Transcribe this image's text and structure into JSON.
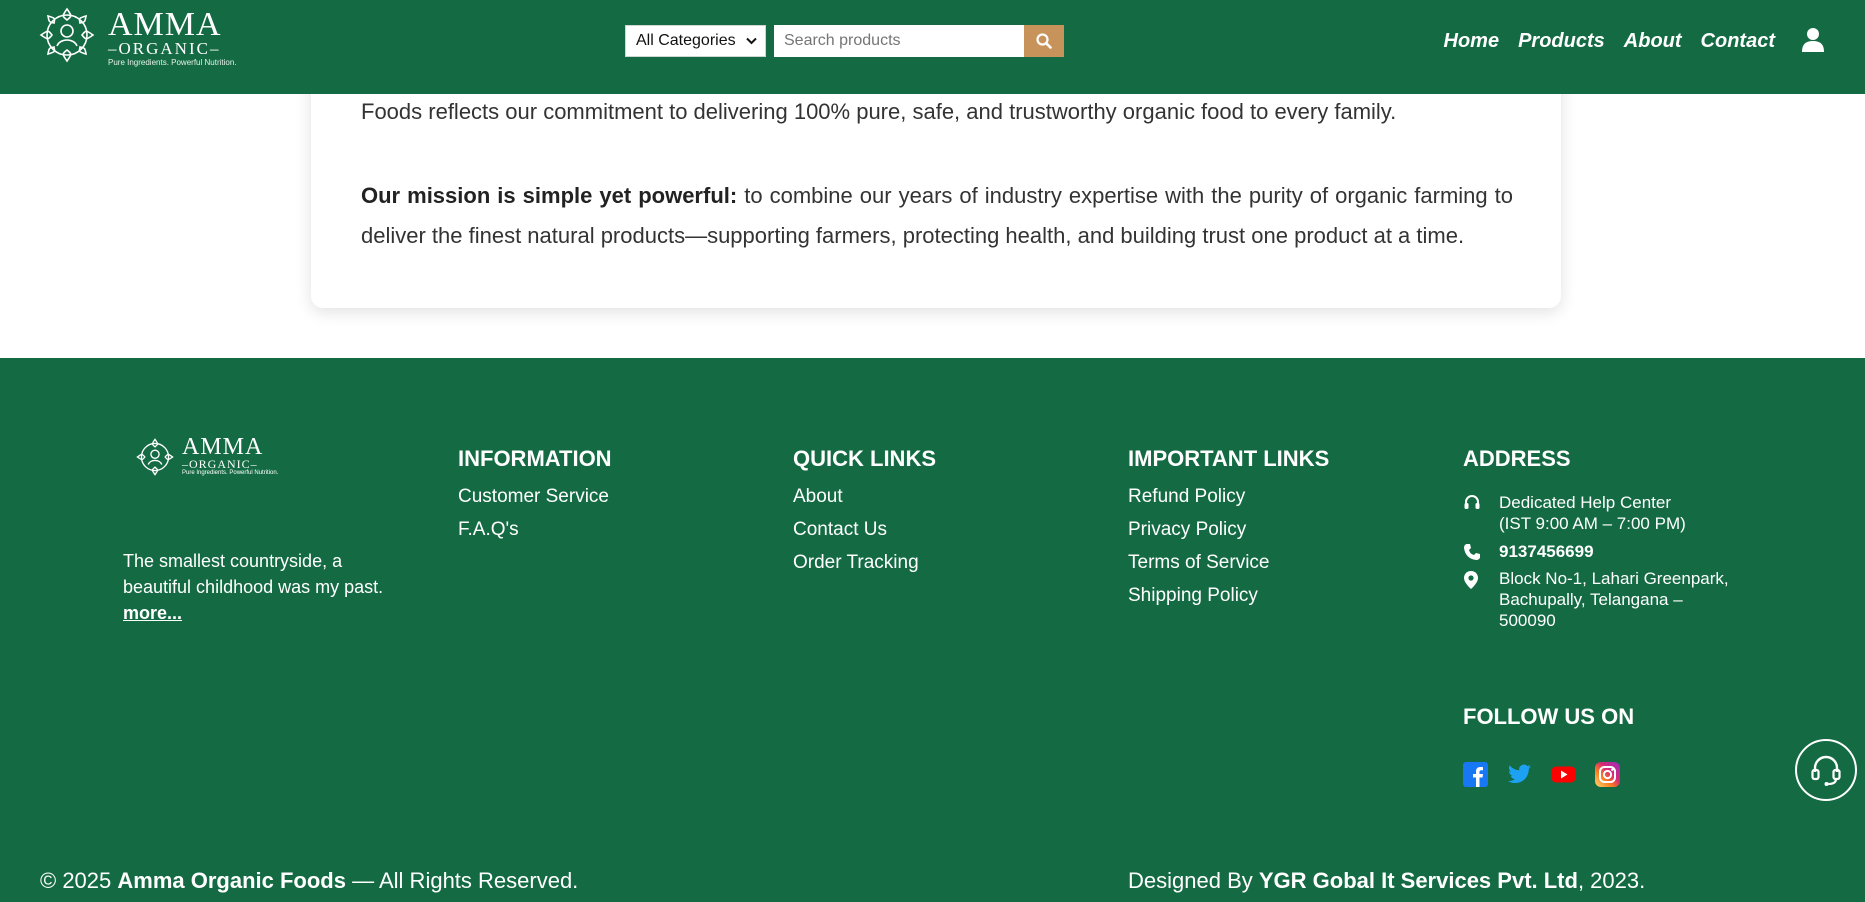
{
  "header": {
    "logo": {
      "title": "AMMA",
      "subtitle": "ORGANIC",
      "tagline": "Pure Ingredients. Powerful Nutrition."
    },
    "search": {
      "category_selected": "All Categories",
      "placeholder": "Search products"
    },
    "nav": [
      "Home",
      "Products",
      "About",
      "Contact"
    ]
  },
  "content": {
    "paragraph_top": "Foods reflects our commitment to delivering 100% pure, safe, and trustworthy organic food to every family.",
    "mission_lead": "Our mission is simple yet powerful:",
    "mission_text": " to combine our years of industry expertise with the purity of organic farming to deliver the finest natural products—supporting farmers, protecting health, and building trust one product at a time."
  },
  "footer": {
    "logo": {
      "title": "AMMA",
      "subtitle": "ORGANIC",
      "tagline": "Pure Ingredients. Powerful Nutrition."
    },
    "about": {
      "text": "The smallest countryside, a beautiful childhood was my past.",
      "more": "more..."
    },
    "information": {
      "title": "INFORMATION",
      "links": [
        "Customer Service",
        "F.A.Q's"
      ]
    },
    "quick_links": {
      "title": "QUICK LINKS",
      "links": [
        "About",
        "Contact Us",
        "Order Tracking"
      ]
    },
    "important_links": {
      "title": "IMPORTANT LINKS",
      "links": [
        "Refund Policy",
        "Privacy Policy",
        "Terms of Service",
        "Shipping Policy"
      ]
    },
    "address": {
      "title": "ADDRESS",
      "help_center_line1": "Dedicated Help Center",
      "help_center_line2": "(IST 9:00 AM – 7:00 PM)",
      "phone": "9137456699",
      "address_line1": "Block No-1, Lahari Greenpark,",
      "address_line2": "Bachupally, Telangana –",
      "address_line3": "500090"
    },
    "follow": {
      "title": "FOLLOW US ON",
      "icons": [
        "facebook-icon",
        "twitter-icon",
        "youtube-icon",
        "instagram-icon"
      ]
    },
    "copyright": {
      "prefix": "© 2025 ",
      "brand": "Amma Organic Foods",
      "suffix": " — All Rights Reserved."
    },
    "designed": {
      "prefix": "Designed By ",
      "company": "YGR Gobal It Services Pvt. Ltd",
      "suffix": ", 2023."
    }
  },
  "colors": {
    "brand_green": "#146b43",
    "search_button": "#c8935b"
  }
}
